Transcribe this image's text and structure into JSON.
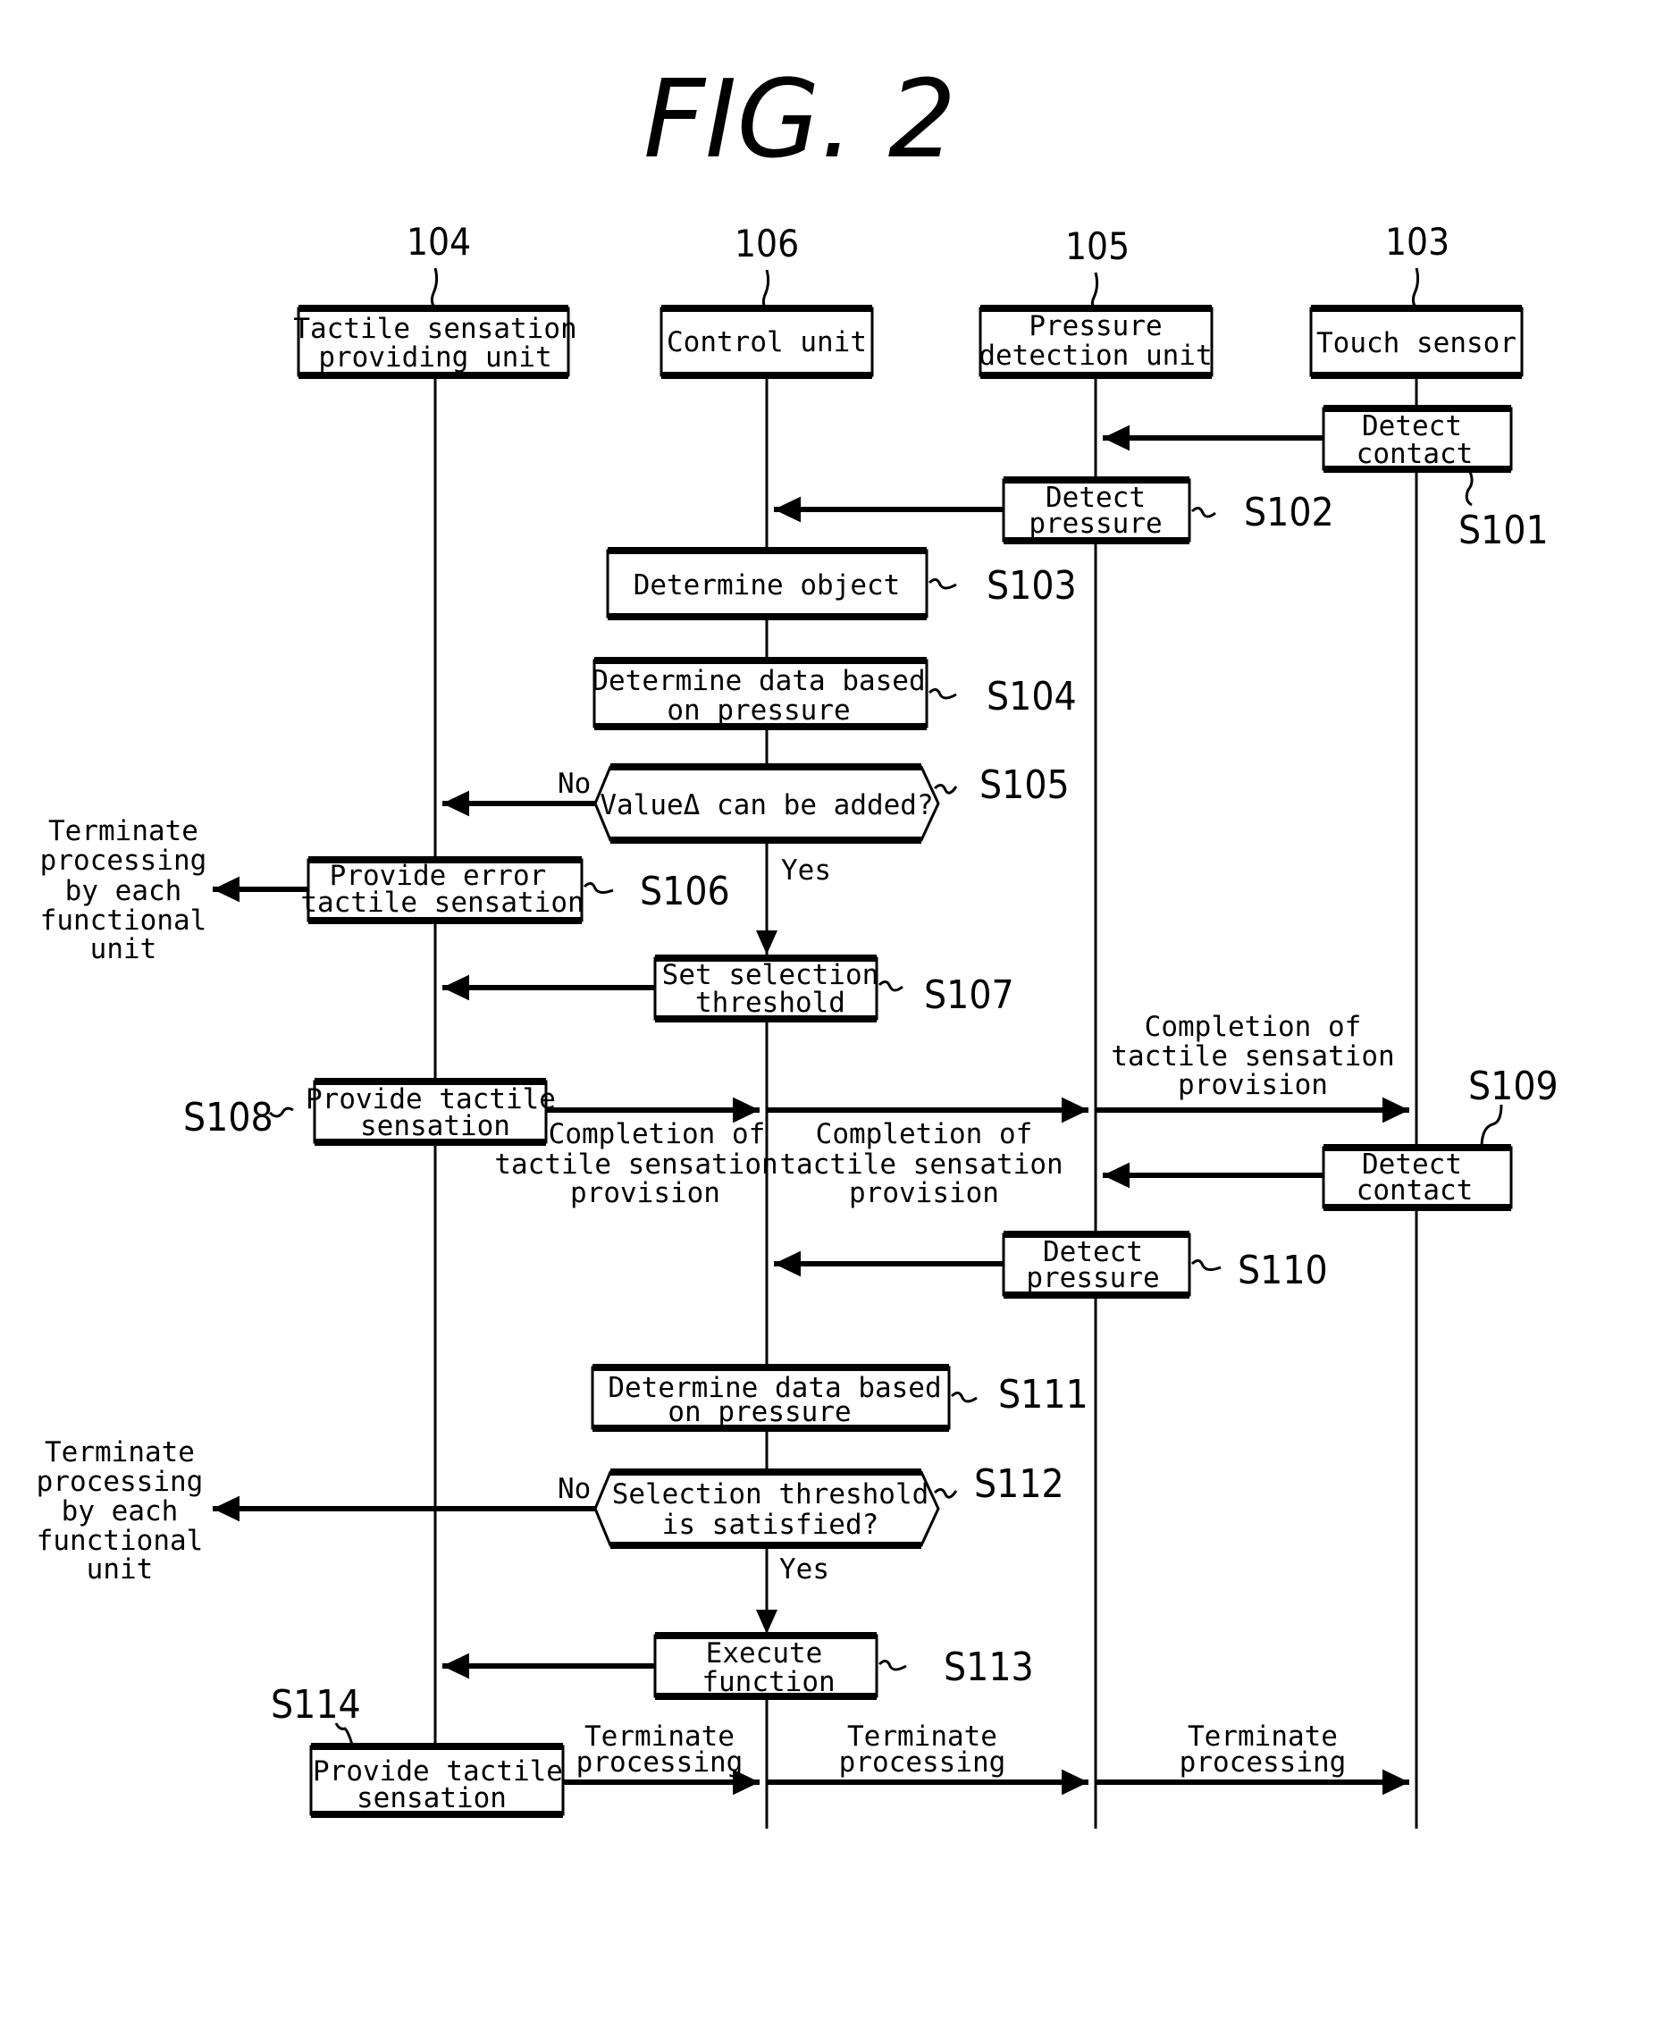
{
  "figure": {
    "title": "FIG. 2"
  },
  "lifelines": [
    {
      "ref": "104",
      "label": [
        "Tactile sensation",
        "providing unit"
      ]
    },
    {
      "ref": "106",
      "label": [
        "Control unit"
      ]
    },
    {
      "ref": "105",
      "label": [
        "Pressure",
        "detection unit"
      ]
    },
    {
      "ref": "103",
      "label": [
        "Touch sensor"
      ]
    }
  ],
  "steps": {
    "s101": {
      "id": "S101",
      "label": [
        "Detect",
        "contact"
      ]
    },
    "s102": {
      "id": "S102",
      "label": [
        "Detect",
        "pressure"
      ]
    },
    "s103": {
      "id": "S103",
      "label": [
        "Determine object"
      ]
    },
    "s104": {
      "id": "S104",
      "label": [
        "Determine data based",
        "on pressure"
      ]
    },
    "s105": {
      "id": "S105",
      "label": [
        "ValueΔ  can be added?"
      ],
      "no": "No",
      "yes": "Yes"
    },
    "s106": {
      "id": "S106",
      "label": [
        "Provide error",
        "tactile sensation"
      ]
    },
    "s107": {
      "id": "S107",
      "label": [
        "Set selection",
        "threshold"
      ]
    },
    "s108": {
      "id": "S108",
      "label": [
        "Provide tactile",
        "sensation"
      ]
    },
    "s109": {
      "id": "S109",
      "label": [
        "Detect",
        "contact"
      ]
    },
    "s110": {
      "id": "S110",
      "label": [
        "Detect",
        "pressure"
      ]
    },
    "s111": {
      "id": "S111",
      "label": [
        "Determine data based",
        "on pressure"
      ]
    },
    "s112": {
      "id": "S112",
      "label": [
        "Selection threshold",
        "is satisfied?"
      ],
      "no": "No",
      "yes": "Yes"
    },
    "s113": {
      "id": "S113",
      "label": [
        "Execute",
        "function"
      ]
    },
    "s114": {
      "id": "S114",
      "label": [
        "Provide tactile",
        "sensation"
      ]
    }
  },
  "messages": {
    "terminate_each": [
      "Terminate",
      "processing",
      "by each",
      "functional",
      "unit"
    ],
    "completion": [
      "Completion of",
      "tactile sensation",
      "provision"
    ],
    "terminate": [
      "Terminate",
      "processing"
    ]
  }
}
